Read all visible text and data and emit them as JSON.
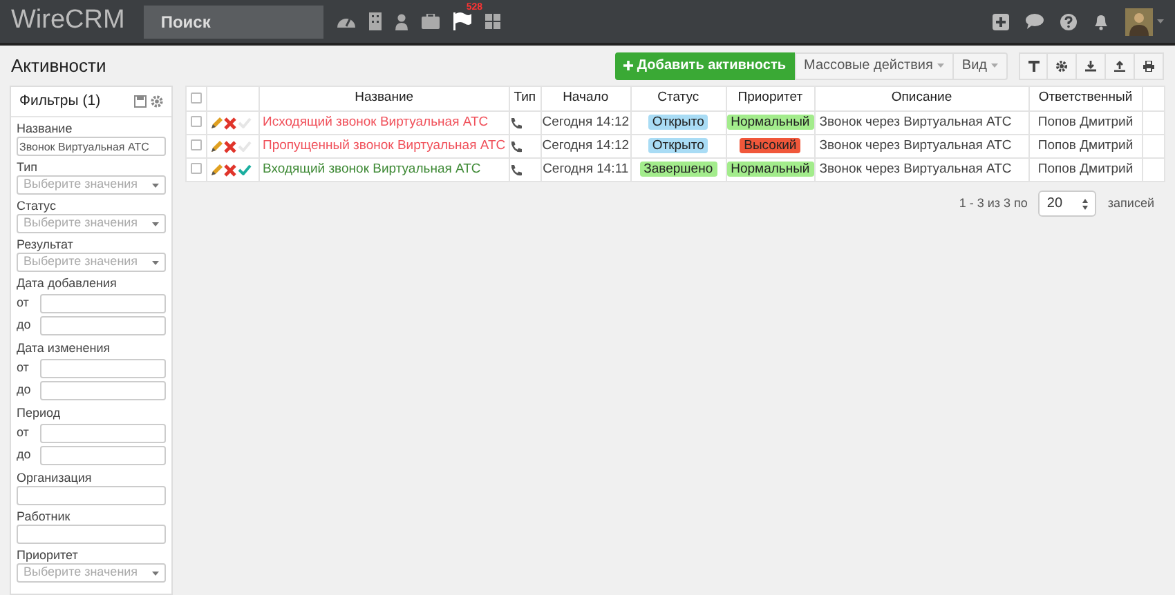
{
  "navbar": {
    "logo": "WireCRM",
    "search": {
      "placeholder": "Поиск"
    },
    "notification_count": "528"
  },
  "page_title": "Активности",
  "toolbar": {
    "add_button": "Добавить активность",
    "bulk_actions": "Массовые действия",
    "view": "Вид"
  },
  "filters": {
    "title": "Фильтры (1)",
    "fields": [
      {
        "kind": "text",
        "label": "Название",
        "value": "Звонок Виртуальная АТС"
      },
      {
        "kind": "select",
        "label": "Тип",
        "placeholder": "Выберите значения"
      },
      {
        "kind": "select",
        "label": "Статус",
        "placeholder": "Выберите значения"
      },
      {
        "kind": "select",
        "label": "Результат",
        "placeholder": "Выберите значения"
      },
      {
        "kind": "range",
        "label": "Дата добавления",
        "from": "от",
        "to": "до"
      },
      {
        "kind": "range",
        "label": "Дата изменения",
        "from": "от",
        "to": "до"
      },
      {
        "kind": "range",
        "label": "Период",
        "from": "от",
        "to": "до"
      },
      {
        "kind": "text",
        "label": "Организация"
      },
      {
        "kind": "text",
        "label": "Работник"
      },
      {
        "kind": "select",
        "label": "Приоритет",
        "placeholder": "Выберите значения"
      }
    ]
  },
  "table": {
    "select_all_checked": false,
    "columns": [
      "Название",
      "Тип",
      "Начало",
      "Статус",
      "Приоритет",
      "Описание",
      "Ответственный"
    ],
    "rows": [
      {
        "checked": false,
        "done": false,
        "name": {
          "text": "Исходящий звонок Виртуальная АТС",
          "color": "#f0505a"
        },
        "start": "Сегодня 14:12",
        "status": {
          "text": "Открыто",
          "color": "#a9dcf5"
        },
        "priority": {
          "text": "Нормальный",
          "color": "#a3ec8c"
        },
        "description": "Звонок через Виртуальная АТС",
        "owner": "Попов Дмитрий"
      },
      {
        "checked": false,
        "done": false,
        "name": {
          "text": "Пропущенный звонок Виртуальная АТС",
          "color": "#f0505a"
        },
        "start": "Сегодня 14:12",
        "status": {
          "text": "Открыто",
          "color": "#a9dcf5"
        },
        "priority": {
          "text": "Высокий",
          "color": "#f0573a"
        },
        "description": "Звонок через Виртуальная АТС",
        "owner": "Попов Дмитрий"
      },
      {
        "checked": false,
        "done": true,
        "name": {
          "text": "Входящий звонок Виртуальная АТС",
          "color": "#3f8a36"
        },
        "start": "Сегодня 14:11",
        "status": {
          "text": "Завершено",
          "color": "#a3ec8c"
        },
        "priority": {
          "text": "Нормальный",
          "color": "#a3ec8c"
        },
        "description": "Звонок через Виртуальная АТС",
        "owner": "Попов Дмитрий"
      }
    ]
  },
  "pagination": {
    "summary": "1 - 3 из 3 по",
    "page_size": "20",
    "suffix": "записей"
  }
}
